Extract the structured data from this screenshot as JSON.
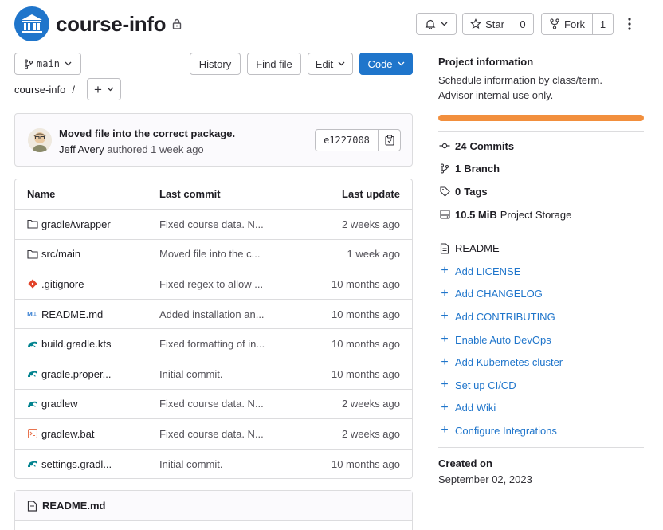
{
  "project": {
    "name": "course-info"
  },
  "header_actions": {
    "star_label": "Star",
    "star_count": "0",
    "fork_label": "Fork",
    "fork_count": "1"
  },
  "toolbar": {
    "branch": "main",
    "history": "History",
    "find_file": "Find file",
    "edit": "Edit",
    "code": "Code",
    "breadcrumb_root": "course-info",
    "breadcrumb_sep": "/"
  },
  "last_commit": {
    "message": "Moved file into the correct package.",
    "author": "Jeff Avery",
    "verb_time": "authored 1 week ago",
    "sha": "e1227008"
  },
  "file_table": {
    "headers": {
      "name": "Name",
      "last_commit": "Last commit",
      "last_update": "Last update"
    },
    "rows": [
      {
        "name": "gradle/wrapper",
        "icon": "folder-icon",
        "commit": "Fixed course data. N...",
        "updated": "2 weeks ago"
      },
      {
        "name": "src/main",
        "icon": "folder-icon",
        "commit": "Moved file into the c...",
        "updated": "1 week ago"
      },
      {
        "name": ".gitignore",
        "icon": "git-icon",
        "commit": "Fixed regex to allow ...",
        "updated": "10 months ago"
      },
      {
        "name": "README.md",
        "icon": "markdown-icon",
        "commit": "Added installation an...",
        "updated": "10 months ago"
      },
      {
        "name": "build.gradle.kts",
        "icon": "gradle-icon",
        "commit": "Fixed formatting of in...",
        "updated": "10 months ago"
      },
      {
        "name": "gradle.proper...",
        "icon": "gradle-icon",
        "commit": "Initial commit.",
        "updated": "10 months ago"
      },
      {
        "name": "gradlew",
        "icon": "gradle-icon",
        "commit": "Fixed course data. N...",
        "updated": "2 weeks ago"
      },
      {
        "name": "gradlew.bat",
        "icon": "terminal-icon",
        "commit": "Fixed course data. N...",
        "updated": "2 weeks ago"
      },
      {
        "name": "settings.gradl...",
        "icon": "gradle-icon",
        "commit": "Initial commit.",
        "updated": "10 months ago"
      }
    ]
  },
  "readme": {
    "title": "README.md"
  },
  "sidebar": {
    "title": "Project information",
    "description_line1": "Schedule information by class/term.",
    "description_line2": "Advisor internal use only.",
    "stats": {
      "commits_count": "24",
      "commits_label": "Commits",
      "branch_count": "1",
      "branch_label": "Branch",
      "tags_count": "0",
      "tags_label": "Tags",
      "storage_size": "10.5 MiB",
      "storage_label": "Project Storage"
    },
    "readme_label": "README",
    "links": [
      "Add LICENSE",
      "Add CHANGELOG",
      "Add CONTRIBUTING",
      "Enable Auto DevOps",
      "Add Kubernetes cluster",
      "Set up CI/CD",
      "Add Wiki",
      "Configure Integrations"
    ],
    "created_title": "Created on",
    "created_date": "September 02, 2023"
  },
  "colors": {
    "accent": "#1f75cb",
    "storage_bar": "#f28f3d",
    "border": "#dcdcde"
  }
}
